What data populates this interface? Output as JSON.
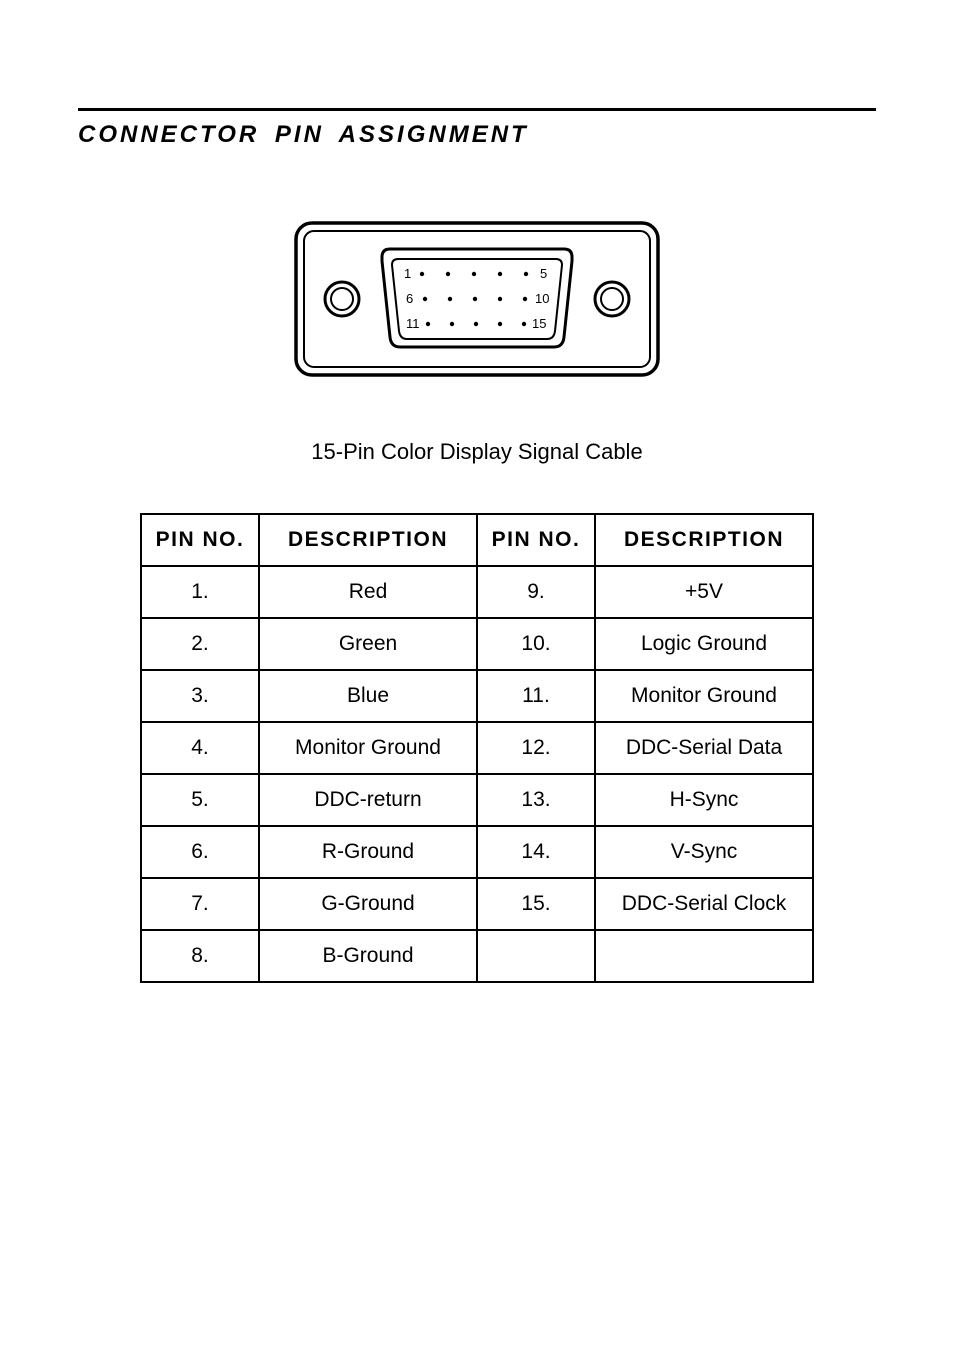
{
  "heading": "CONNECTOR  PIN  ASSIGNMENT",
  "diagram_labels": {
    "r1_start": "1",
    "r1_end": "5",
    "r2_start": "6",
    "r2_end": "10",
    "r3_start": "11",
    "r3_end": "15"
  },
  "caption": "15-Pin Color Display Signal Cable",
  "headers": {
    "pin": "PIN NO.",
    "desc": "DESCRIPTION"
  },
  "rows": [
    {
      "p1": "1.",
      "d1": "Red",
      "p2": "9.",
      "d2": "+5V"
    },
    {
      "p1": "2.",
      "d1": "Green",
      "p2": "10.",
      "d2": "Logic Ground"
    },
    {
      "p1": "3.",
      "d1": "Blue",
      "p2": "11.",
      "d2": "Monitor Ground"
    },
    {
      "p1": "4.",
      "d1": "Monitor Ground",
      "p2": "12.",
      "d2": "DDC-Serial Data"
    },
    {
      "p1": "5.",
      "d1": "DDC-return",
      "p2": "13.",
      "d2": "H-Sync"
    },
    {
      "p1": "6.",
      "d1": "R-Ground",
      "p2": "14.",
      "d2": "V-Sync"
    },
    {
      "p1": "7.",
      "d1": "G-Ground",
      "p2": "15.",
      "d2": "DDC-Serial Clock"
    },
    {
      "p1": "8.",
      "d1": "B-Ground",
      "p2": "",
      "d2": ""
    }
  ]
}
